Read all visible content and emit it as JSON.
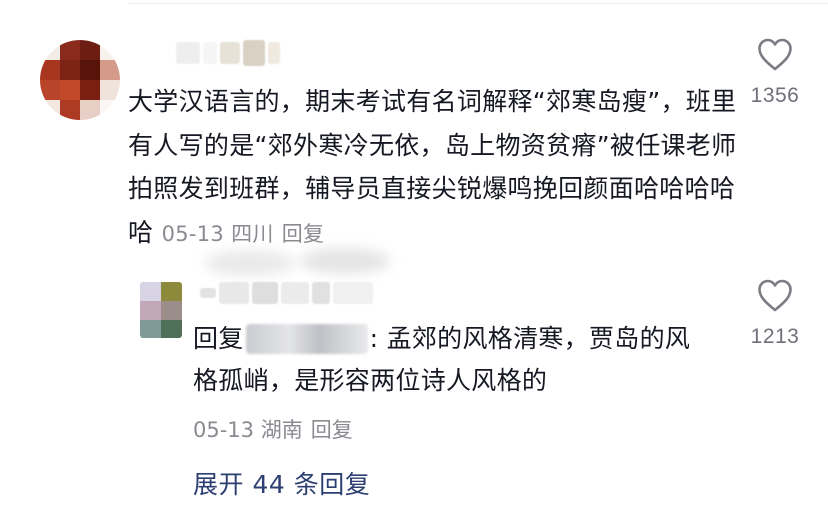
{
  "comment": {
    "body": "大学汉语言的，期末考试有名词解释“郊寒岛瘦”，班里有人写的是“郊外寒冷无依，岛上物资贫瘠”被任课老师拍照发到班群，辅导员直接尖锐爆鸣挽回颜面哈哈哈哈哈",
    "date": "05-13",
    "location": "四川",
    "reply_label": "回复",
    "like_icon": "heart-outline-icon",
    "like_count": "1356"
  },
  "reply": {
    "prefix": "回复",
    "body": ": 孟郊的风格清寒，贾岛的风格孤峭，是形容两位诗人风格的",
    "date": "05-13",
    "location": "湖南",
    "reply_label": "回复",
    "like_icon": "heart-outline-icon",
    "like_count": "1213"
  },
  "expand_replies_label": "展开 44 条回复",
  "colors": {
    "text": "#161823",
    "meta": "#8a8b91",
    "link": "#2c3e72"
  }
}
